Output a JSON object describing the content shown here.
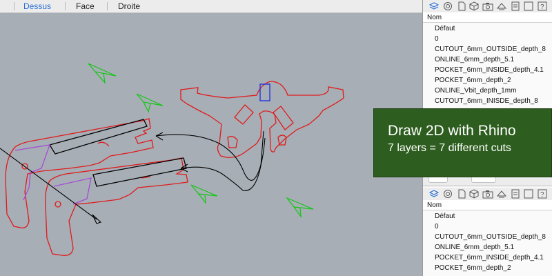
{
  "viewport": {
    "tabs": [
      "Dessus",
      "Face",
      "Droite"
    ],
    "active_tab": "Dessus"
  },
  "layers_panel": {
    "column_header": "Nom",
    "layers_top": [
      "Défaut",
      "0",
      "CUTOUT_6mm_OUTSIDE_depth_8",
      "ONLINE_6mm_depth_5.1",
      "POCKET_6mm_INSIDE_depth_4.1",
      "POCKET_6mm_depth_2",
      "ONLINE_Vbit_depth_1mm",
      "CUTOUT_6mm_INISDE_depth_8"
    ],
    "layers_bottom": [
      "Défaut",
      "0",
      "CUTOUT_6mm_OUTSIDE_depth_8",
      "ONLINE_6mm_depth_5.1",
      "POCKET_6mm_INSIDE_depth_4.1",
      "POCKET_6mm_depth_2"
    ],
    "toolbar_icons": [
      "layers-icon",
      "material-icon",
      "document-icon",
      "cube-icon",
      "camera-icon",
      "lights-icon",
      "notes-icon",
      "panel-icon",
      "help-icon"
    ]
  },
  "banner": {
    "title": "Draw 2D with Rhino",
    "subtitle": "7 layers = 7 different cuts"
  },
  "colors": {
    "viewport_bg": "#a7aeb6",
    "curve_red": "#e11a1a",
    "curve_black": "#000000",
    "curve_purple": "#a64bd6",
    "curve_green": "#12c712",
    "curve_blue": "#1a2fe0",
    "active_tab": "#2b6fd6",
    "banner_bg": "#2e5e1f"
  }
}
